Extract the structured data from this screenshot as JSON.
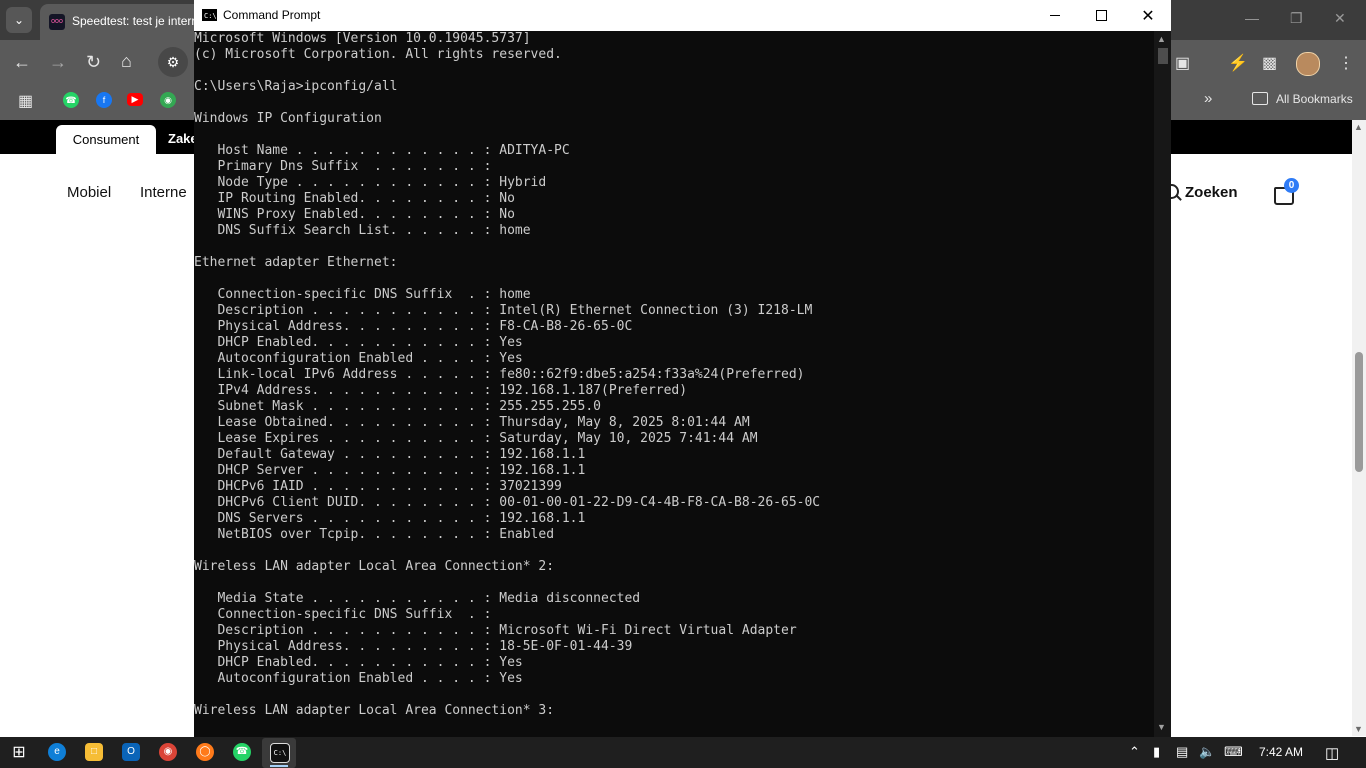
{
  "browser": {
    "tab_title": "Speedtest: test je interr",
    "bookmarks_all_label": "All Bookmarks"
  },
  "page": {
    "top_tabs": [
      "Consument",
      "Zake"
    ],
    "nav": [
      "Mobiel",
      "Interne"
    ],
    "search_label": "Zoeken",
    "cart_count": "0"
  },
  "cmd": {
    "title": "Command Prompt",
    "lines": [
      "Microsoft Windows [Version 10.0.19045.5737]",
      "(c) Microsoft Corporation. All rights reserved.",
      "",
      "C:\\Users\\Raja>ipconfig/all",
      "",
      "Windows IP Configuration",
      "",
      "   Host Name . . . . . . . . . . . . : ADITYA-PC",
      "   Primary Dns Suffix  . . . . . . . :",
      "   Node Type . . . . . . . . . . . . : Hybrid",
      "   IP Routing Enabled. . . . . . . . : No",
      "   WINS Proxy Enabled. . . . . . . . : No",
      "   DNS Suffix Search List. . . . . . : home",
      "",
      "Ethernet adapter Ethernet:",
      "",
      "   Connection-specific DNS Suffix  . : home",
      "   Description . . . . . . . . . . . : Intel(R) Ethernet Connection (3) I218-LM",
      "   Physical Address. . . . . . . . . : F8-CA-B8-26-65-0C",
      "   DHCP Enabled. . . . . . . . . . . : Yes",
      "   Autoconfiguration Enabled . . . . : Yes",
      "   Link-local IPv6 Address . . . . . : fe80::62f9:dbe5:a254:f33a%24(Preferred)",
      "   IPv4 Address. . . . . . . . . . . : 192.168.1.187(Preferred)",
      "   Subnet Mask . . . . . . . . . . . : 255.255.255.0",
      "   Lease Obtained. . . . . . . . . . : Thursday, May 8, 2025 8:01:44 AM",
      "   Lease Expires . . . . . . . . . . : Saturday, May 10, 2025 7:41:44 AM",
      "   Default Gateway . . . . . . . . . : 192.168.1.1",
      "   DHCP Server . . . . . . . . . . . : 192.168.1.1",
      "   DHCPv6 IAID . . . . . . . . . . . : 37021399",
      "   DHCPv6 Client DUID. . . . . . . . : 00-01-00-01-22-D9-C4-4B-F8-CA-B8-26-65-0C",
      "   DNS Servers . . . . . . . . . . . : 192.168.1.1",
      "   NetBIOS over Tcpip. . . . . . . . : Enabled",
      "",
      "Wireless LAN adapter Local Area Connection* 2:",
      "",
      "   Media State . . . . . . . . . . . : Media disconnected",
      "   Connection-specific DNS Suffix  . :",
      "   Description . . . . . . . . . . . : Microsoft Wi-Fi Direct Virtual Adapter",
      "   Physical Address. . . . . . . . . : 18-5E-0F-01-44-39",
      "   DHCP Enabled. . . . . . . . . . . : Yes",
      "   Autoconfiguration Enabled . . . . : Yes",
      "",
      "Wireless LAN adapter Local Area Connection* 3:"
    ]
  },
  "taskbar": {
    "clock": "7:42 AM"
  }
}
